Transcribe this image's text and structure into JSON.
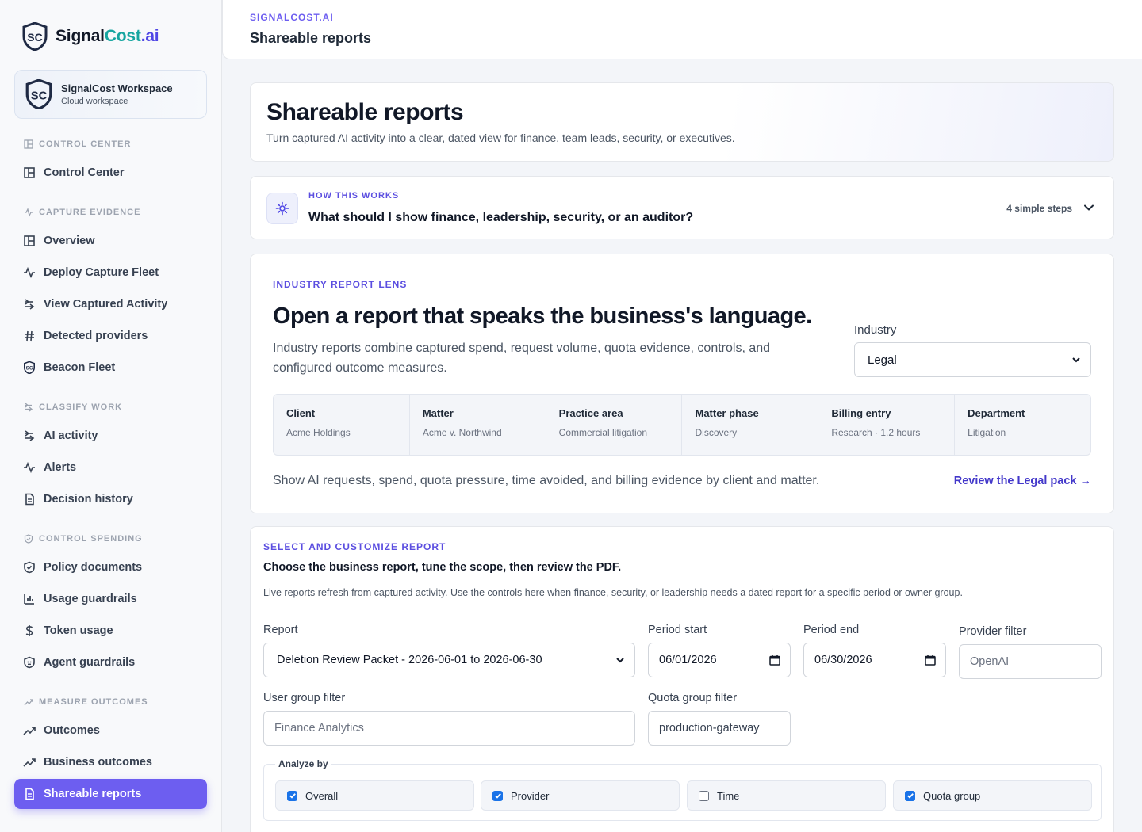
{
  "brand": {
    "name_part1": "Signal",
    "name_part2": "Cost",
    "name_part3": ".ai"
  },
  "workspace": {
    "title": "SignalCost Workspace",
    "subtitle": "Cloud workspace"
  },
  "sidebar": {
    "sections": [
      {
        "label": "CONTROL CENTER",
        "items": [
          "Control Center"
        ]
      },
      {
        "label": "CAPTURE EVIDENCE",
        "items": [
          "Overview",
          "Deploy Capture Fleet",
          "View Captured Activity",
          "Detected providers",
          "Beacon Fleet"
        ]
      },
      {
        "label": "CLASSIFY WORK",
        "items": [
          "AI activity",
          "Alerts",
          "Decision history"
        ]
      },
      {
        "label": "CONTROL SPENDING",
        "items": [
          "Policy documents",
          "Usage guardrails",
          "Token usage",
          "Agent guardrails"
        ]
      },
      {
        "label": "MEASURE OUTCOMES",
        "items": [
          "Outcomes",
          "Business outcomes",
          "Shareable reports"
        ]
      }
    ],
    "active_item": "Shareable reports"
  },
  "header": {
    "breadcrumb": "SIGNALCOST.AI",
    "title": "Shareable reports"
  },
  "hero": {
    "title": "Shareable reports",
    "subtitle": "Turn captured AI activity into a clear, dated view for finance, team leads, security, or executives."
  },
  "how_it_works": {
    "label": "HOW THIS WORKS",
    "question": "What should I show finance, leadership, security, or an auditor?",
    "steps": "4 simple steps"
  },
  "lens": {
    "label": "INDUSTRY REPORT LENS",
    "title": "Open a report that speaks the business's language.",
    "description": "Industry reports combine captured spend, request volume, quota evidence, controls, and configured outcome measures.",
    "industry_label": "Industry",
    "industry_value": "Legal",
    "facets": [
      {
        "key": "Client",
        "value": "Acme Holdings"
      },
      {
        "key": "Matter",
        "value": "Acme v. Northwind"
      },
      {
        "key": "Practice area",
        "value": "Commercial litigation"
      },
      {
        "key": "Matter phase",
        "value": "Discovery"
      },
      {
        "key": "Billing entry",
        "value": "Research · 1.2 hours"
      },
      {
        "key": "Department",
        "value": "Litigation"
      }
    ],
    "footer": "Show AI requests, spend, quota pressure, time avoided, and billing evidence by client and matter.",
    "link": "Review the Legal pack →"
  },
  "customize": {
    "label": "SELECT AND CUSTOMIZE REPORT",
    "title": "Choose the business report, tune the scope, then review the PDF.",
    "description": "Live reports refresh from captured activity. Use the controls here when finance, security, or leadership needs a dated report for a specific period or owner group.",
    "report_label": "Report",
    "report_value": "Deletion Review Packet - 2026-06-01 to 2026-06-30",
    "period_start_label": "Period start",
    "period_start": "06/01/2026",
    "period_end_label": "Period end",
    "period_end": "06/30/2026",
    "provider_filter_label": "Provider filter",
    "provider_filter_placeholder": "OpenAI",
    "user_group_label": "User group filter",
    "user_group_placeholder": "Finance Analytics",
    "quota_group_label": "Quota group filter",
    "quota_group_value": "production-gateway",
    "analyze_by": {
      "title": "Analyze by",
      "options": [
        {
          "label": "Overall",
          "checked": true
        },
        {
          "label": "Provider",
          "checked": true
        },
        {
          "label": "Time",
          "checked": false
        },
        {
          "label": "Quota group",
          "checked": true
        }
      ]
    }
  },
  "colors": {
    "accent": "#6d5ef0",
    "brand_teal": "#16a5a0",
    "link": "#4338ca"
  }
}
